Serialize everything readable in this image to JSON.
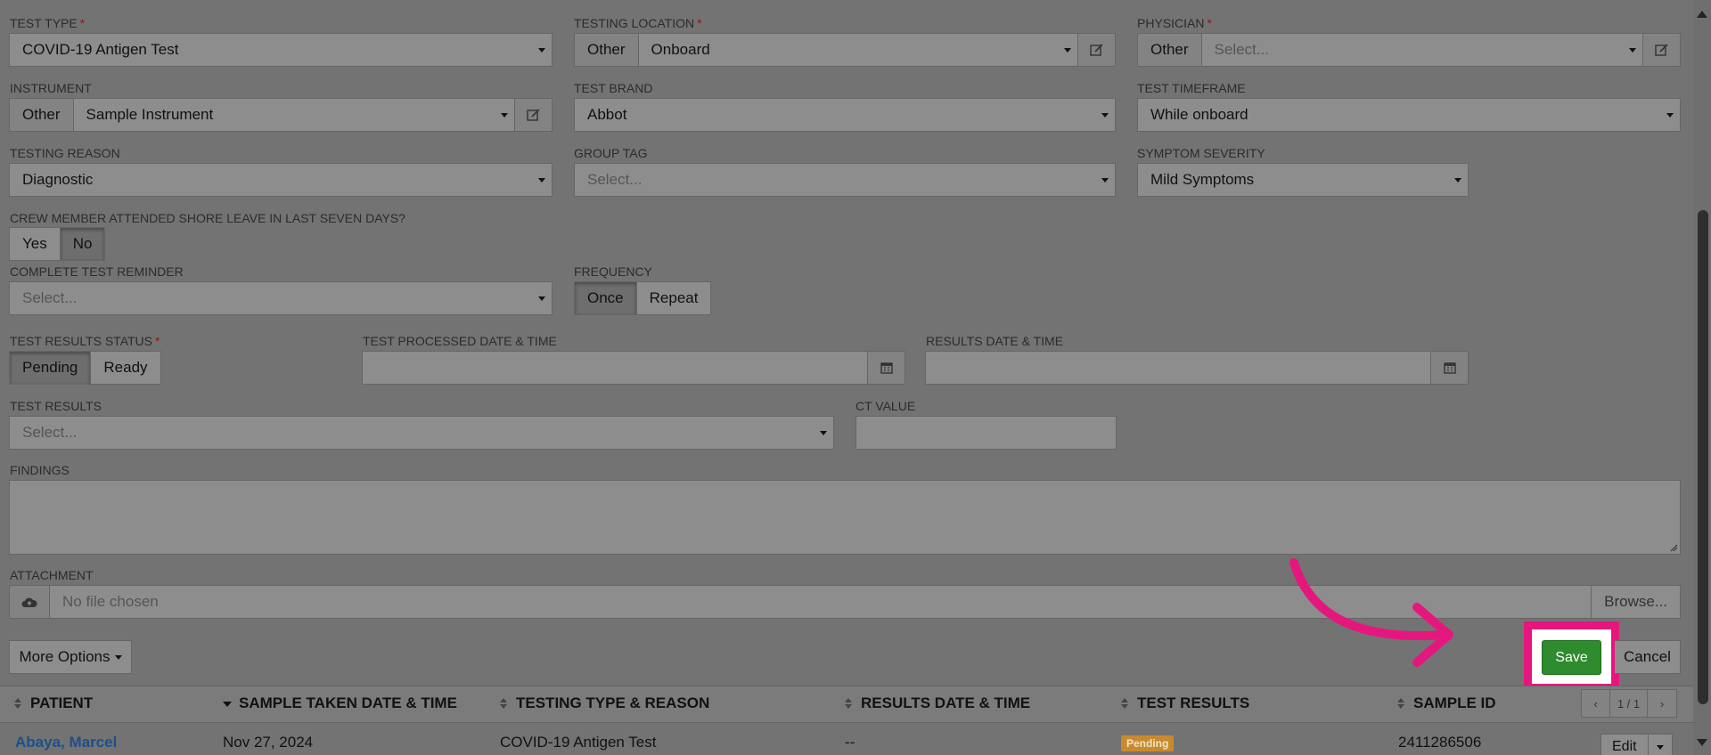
{
  "form": {
    "test_type": {
      "label": "TEST TYPE",
      "required_mark": "*",
      "value": "COVID-19 Antigen Test"
    },
    "testing_location": {
      "label": "TESTING LOCATION",
      "required_mark": "*",
      "addon": "Other",
      "value": "Onboard"
    },
    "physician": {
      "label": "PHYSICIAN",
      "required_mark": "*",
      "addon": "Other",
      "placeholder": "Select..."
    },
    "instrument": {
      "label": "INSTRUMENT",
      "addon": "Other",
      "value": "Sample Instrument"
    },
    "test_brand": {
      "label": "TEST BRAND",
      "value": "Abbot"
    },
    "test_timeframe": {
      "label": "TEST TIMEFRAME",
      "value": "While onboard"
    },
    "testing_reason": {
      "label": "TESTING REASON",
      "value": "Diagnostic"
    },
    "group_tag": {
      "label": "GROUP TAG",
      "placeholder": "Select..."
    },
    "symptom_severity": {
      "label": "SYMPTOM SEVERITY",
      "value": "Mild Symptoms"
    },
    "shore_leave": {
      "label": "CREW MEMBER ATTENDED SHORE LEAVE IN LAST SEVEN DAYS?",
      "options": [
        "Yes",
        "No"
      ],
      "selected": "No"
    },
    "complete_test_reminder": {
      "label": "COMPLETE TEST REMINDER",
      "placeholder": "Select..."
    },
    "frequency": {
      "label": "FREQUENCY",
      "options": [
        "Once",
        "Repeat"
      ],
      "selected": "Once"
    },
    "test_results_status": {
      "label": "TEST RESULTS STATUS",
      "required_mark": "*",
      "options": [
        "Pending",
        "Ready"
      ],
      "selected": "Pending"
    },
    "test_processed_datetime": {
      "label": "TEST PROCESSED DATE & TIME",
      "value": ""
    },
    "results_datetime": {
      "label": "RESULTS DATE & TIME",
      "value": ""
    },
    "test_results": {
      "label": "TEST RESULTS",
      "placeholder": "Select..."
    },
    "ct_value": {
      "label": "CT VALUE",
      "value": ""
    },
    "findings": {
      "label": "FINDINGS",
      "value": ""
    },
    "attachment": {
      "label": "ATTACHMENT",
      "placeholder": "No file chosen",
      "browse_label": "Browse..."
    }
  },
  "actions": {
    "more_options": "More Options",
    "save": "Save",
    "cancel": "Cancel"
  },
  "table": {
    "columns": [
      "PATIENT",
      "SAMPLE TAKEN DATE & TIME",
      "TESTING TYPE & REASON",
      "RESULTS DATE & TIME",
      "TEST RESULTS",
      "SAMPLE ID"
    ],
    "pagination": "1 / 1",
    "rows": [
      {
        "patient": "Abaya, Marcel",
        "sample_taken": "Nov 27, 2024",
        "testing_type": "COVID-19 Antigen Test",
        "results_datetime": "--",
        "status": "Pending",
        "sample_id": "2411286506",
        "edit_label": "Edit"
      }
    ]
  },
  "colors": {
    "overlay_bg": "#737373",
    "highlight_magenta": "#e5177e",
    "save_green": "#2e8b2e",
    "pending_badge": "#c98a2e",
    "patient_link": "#1f4f8a"
  }
}
